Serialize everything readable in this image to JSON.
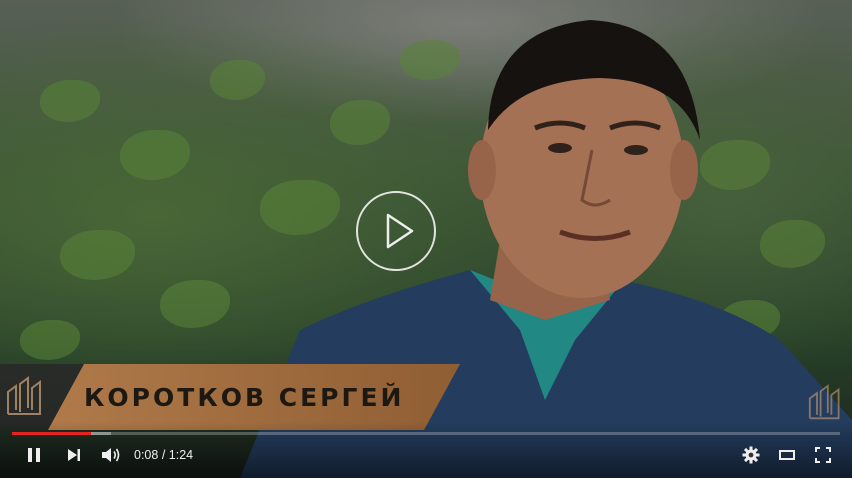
{
  "video": {
    "name_banner": "КОРОТКОВ  СЕРГЕЙ"
  },
  "controls": {
    "current_time": "0:08",
    "separator": " / ",
    "duration": "1:24",
    "progress_fraction": 0.095,
    "buffered_fraction": 0.12,
    "buttons": {
      "play_pause": "pause-icon",
      "next": "next-icon",
      "volume": "volume-icon",
      "settings": "gear-icon",
      "theater": "theater-mode-icon",
      "fullscreen": "fullscreen-icon",
      "center_play": "play-icon"
    }
  },
  "colors": {
    "progress_played": "#e52323",
    "banner_plate": "#a06c3f",
    "banner_text": "#1e1812"
  }
}
